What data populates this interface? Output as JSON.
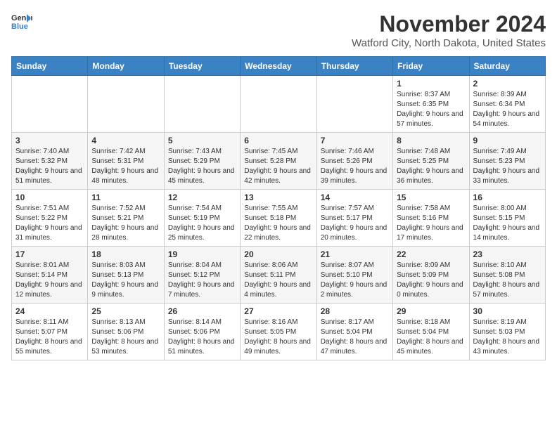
{
  "header": {
    "logo_line1": "General",
    "logo_line2": "Blue",
    "month_title": "November 2024",
    "location": "Watford City, North Dakota, United States"
  },
  "days_of_week": [
    "Sunday",
    "Monday",
    "Tuesday",
    "Wednesday",
    "Thursday",
    "Friday",
    "Saturday"
  ],
  "weeks": [
    [
      {
        "day": "",
        "info": ""
      },
      {
        "day": "",
        "info": ""
      },
      {
        "day": "",
        "info": ""
      },
      {
        "day": "",
        "info": ""
      },
      {
        "day": "",
        "info": ""
      },
      {
        "day": "1",
        "info": "Sunrise: 8:37 AM\nSunset: 6:35 PM\nDaylight: 9 hours and 57 minutes."
      },
      {
        "day": "2",
        "info": "Sunrise: 8:39 AM\nSunset: 6:34 PM\nDaylight: 9 hours and 54 minutes."
      }
    ],
    [
      {
        "day": "3",
        "info": "Sunrise: 7:40 AM\nSunset: 5:32 PM\nDaylight: 9 hours and 51 minutes."
      },
      {
        "day": "4",
        "info": "Sunrise: 7:42 AM\nSunset: 5:31 PM\nDaylight: 9 hours and 48 minutes."
      },
      {
        "day": "5",
        "info": "Sunrise: 7:43 AM\nSunset: 5:29 PM\nDaylight: 9 hours and 45 minutes."
      },
      {
        "day": "6",
        "info": "Sunrise: 7:45 AM\nSunset: 5:28 PM\nDaylight: 9 hours and 42 minutes."
      },
      {
        "day": "7",
        "info": "Sunrise: 7:46 AM\nSunset: 5:26 PM\nDaylight: 9 hours and 39 minutes."
      },
      {
        "day": "8",
        "info": "Sunrise: 7:48 AM\nSunset: 5:25 PM\nDaylight: 9 hours and 36 minutes."
      },
      {
        "day": "9",
        "info": "Sunrise: 7:49 AM\nSunset: 5:23 PM\nDaylight: 9 hours and 33 minutes."
      }
    ],
    [
      {
        "day": "10",
        "info": "Sunrise: 7:51 AM\nSunset: 5:22 PM\nDaylight: 9 hours and 31 minutes."
      },
      {
        "day": "11",
        "info": "Sunrise: 7:52 AM\nSunset: 5:21 PM\nDaylight: 9 hours and 28 minutes."
      },
      {
        "day": "12",
        "info": "Sunrise: 7:54 AM\nSunset: 5:19 PM\nDaylight: 9 hours and 25 minutes."
      },
      {
        "day": "13",
        "info": "Sunrise: 7:55 AM\nSunset: 5:18 PM\nDaylight: 9 hours and 22 minutes."
      },
      {
        "day": "14",
        "info": "Sunrise: 7:57 AM\nSunset: 5:17 PM\nDaylight: 9 hours and 20 minutes."
      },
      {
        "day": "15",
        "info": "Sunrise: 7:58 AM\nSunset: 5:16 PM\nDaylight: 9 hours and 17 minutes."
      },
      {
        "day": "16",
        "info": "Sunrise: 8:00 AM\nSunset: 5:15 PM\nDaylight: 9 hours and 14 minutes."
      }
    ],
    [
      {
        "day": "17",
        "info": "Sunrise: 8:01 AM\nSunset: 5:14 PM\nDaylight: 9 hours and 12 minutes."
      },
      {
        "day": "18",
        "info": "Sunrise: 8:03 AM\nSunset: 5:13 PM\nDaylight: 9 hours and 9 minutes."
      },
      {
        "day": "19",
        "info": "Sunrise: 8:04 AM\nSunset: 5:12 PM\nDaylight: 9 hours and 7 minutes."
      },
      {
        "day": "20",
        "info": "Sunrise: 8:06 AM\nSunset: 5:11 PM\nDaylight: 9 hours and 4 minutes."
      },
      {
        "day": "21",
        "info": "Sunrise: 8:07 AM\nSunset: 5:10 PM\nDaylight: 9 hours and 2 minutes."
      },
      {
        "day": "22",
        "info": "Sunrise: 8:09 AM\nSunset: 5:09 PM\nDaylight: 9 hours and 0 minutes."
      },
      {
        "day": "23",
        "info": "Sunrise: 8:10 AM\nSunset: 5:08 PM\nDaylight: 8 hours and 57 minutes."
      }
    ],
    [
      {
        "day": "24",
        "info": "Sunrise: 8:11 AM\nSunset: 5:07 PM\nDaylight: 8 hours and 55 minutes."
      },
      {
        "day": "25",
        "info": "Sunrise: 8:13 AM\nSunset: 5:06 PM\nDaylight: 8 hours and 53 minutes."
      },
      {
        "day": "26",
        "info": "Sunrise: 8:14 AM\nSunset: 5:06 PM\nDaylight: 8 hours and 51 minutes."
      },
      {
        "day": "27",
        "info": "Sunrise: 8:16 AM\nSunset: 5:05 PM\nDaylight: 8 hours and 49 minutes."
      },
      {
        "day": "28",
        "info": "Sunrise: 8:17 AM\nSunset: 5:04 PM\nDaylight: 8 hours and 47 minutes."
      },
      {
        "day": "29",
        "info": "Sunrise: 8:18 AM\nSunset: 5:04 PM\nDaylight: 8 hours and 45 minutes."
      },
      {
        "day": "30",
        "info": "Sunrise: 8:19 AM\nSunset: 5:03 PM\nDaylight: 8 hours and 43 minutes."
      }
    ]
  ]
}
